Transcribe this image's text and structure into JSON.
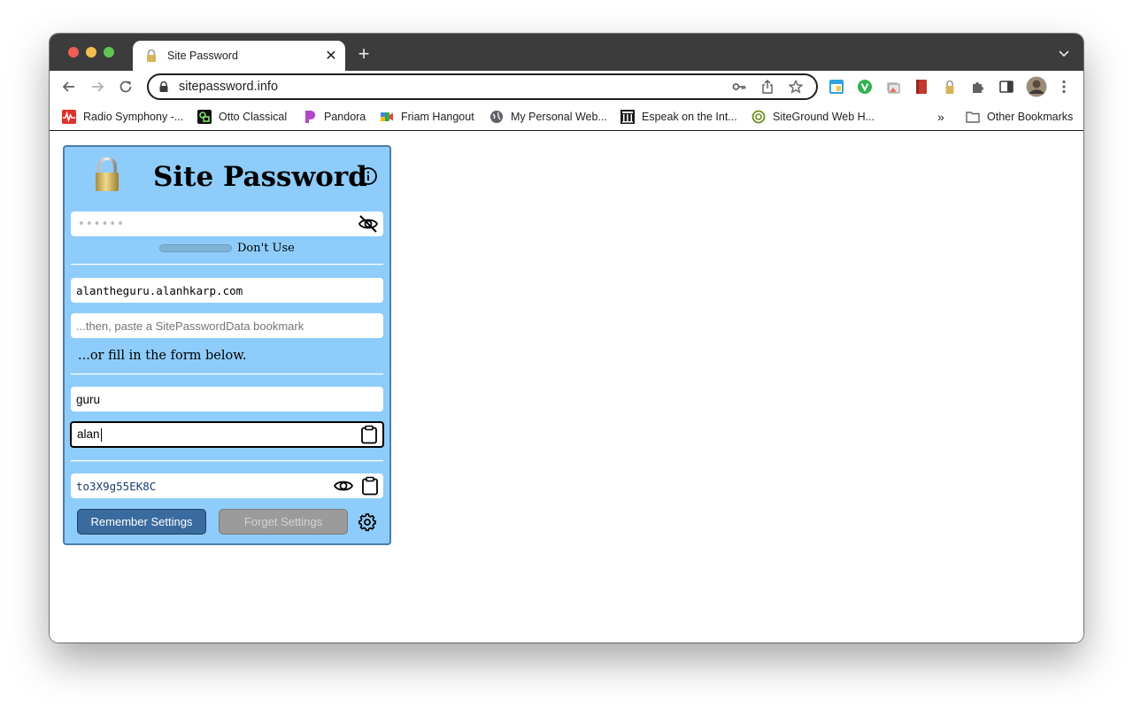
{
  "browser": {
    "tab_title": "Site Password",
    "url": "sitepassword.info",
    "bookmarks": [
      {
        "label": "Radio Symphony -...",
        "icon": "radio-wave-icon"
      },
      {
        "label": "Otto Classical",
        "icon": "otto-icon"
      },
      {
        "label": "Pandora",
        "icon": "pandora-icon"
      },
      {
        "label": "Friam Hangout",
        "icon": "meet-icon"
      },
      {
        "label": "My Personal Web...",
        "icon": "globe-icon"
      },
      {
        "label": "Espeak on the Int...",
        "icon": "building-icon"
      },
      {
        "label": "SiteGround Web H...",
        "icon": "siteground-icon"
      }
    ],
    "other_bookmarks": "Other Bookmarks",
    "overflow": "»",
    "new_tab": "+",
    "close_tab": "✕"
  },
  "app": {
    "title": "Site Password",
    "super_password_mask": "••••••",
    "strength_label": "Don't Use",
    "domain_value": "alantheguru.alanhkarp.com",
    "bookmark_placeholder": "...then, paste a SitePasswordData bookmark",
    "or_text": "...or fill in the form below.",
    "site_name": "guru",
    "username": "alan",
    "site_password": "to3X9g55EK8C",
    "remember_label": "Remember Settings",
    "forget_label": "Forget Settings"
  },
  "colors": {
    "panel_bg": "#8ecdfb",
    "remember_bg": "#3a6b9e",
    "forget_bg": "#9b9b9b"
  }
}
